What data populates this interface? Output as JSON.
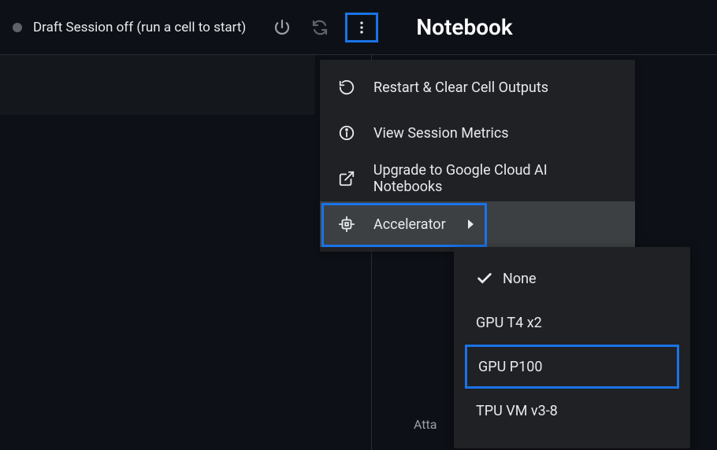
{
  "status": {
    "text": "Draft Session off (run a cell to start)"
  },
  "title": "Notebook",
  "menu": {
    "restart": "Restart & Clear Cell Outputs",
    "metrics": "View Session Metrics",
    "upgrade": "Upgrade to Google Cloud AI Notebooks",
    "accelerator": "Accelerator"
  },
  "accelerator_options": {
    "none": "None",
    "t4": "GPU T4 x2",
    "p100": "GPU P100",
    "tpu": "TPU VM v3-8"
  },
  "footer": {
    "attach": "Atta"
  }
}
